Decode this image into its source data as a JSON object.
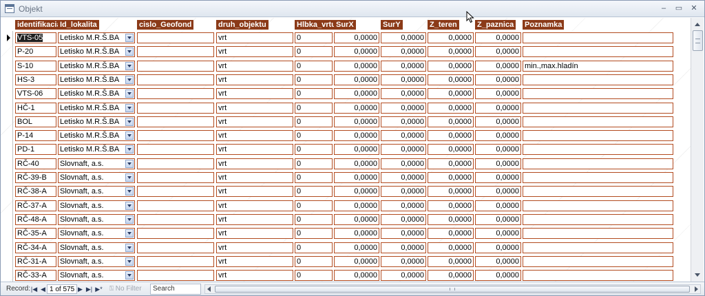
{
  "window": {
    "title": "Objekt"
  },
  "columns": [
    "identifikacia",
    "Id_lokalita",
    "cislo_Geofond",
    "druh_objektu",
    "Hlbka_vrtu",
    "SurX",
    "SurY",
    "Z_teren",
    "Z_paznica",
    "Poznamka"
  ],
  "rows": [
    {
      "identifikacia": "VTS-05",
      "lokalita": "Letisko M.R.Š.BA",
      "geofond": "",
      "druh": "vrt",
      "hlbka": "0",
      "surx": "0,0000",
      "sury": "0,0000",
      "zteren": "0,0000",
      "zpaznica": "0,0000",
      "poznamka": ""
    },
    {
      "identifikacia": "P-20",
      "lokalita": "Letisko M.R.Š.BA",
      "geofond": "",
      "druh": "vrt",
      "hlbka": "0",
      "surx": "0,0000",
      "sury": "0,0000",
      "zteren": "0,0000",
      "zpaznica": "0,0000",
      "poznamka": ""
    },
    {
      "identifikacia": "S-10",
      "lokalita": "Letisko M.R.Š.BA",
      "geofond": "",
      "druh": "vrt",
      "hlbka": "0",
      "surx": "0,0000",
      "sury": "0,0000",
      "zteren": "0,0000",
      "zpaznica": "0,0000",
      "poznamka": "min.,max.hladín"
    },
    {
      "identifikacia": "HS-3",
      "lokalita": "Letisko M.R.Š.BA",
      "geofond": "",
      "druh": "vrt",
      "hlbka": "0",
      "surx": "0,0000",
      "sury": "0,0000",
      "zteren": "0,0000",
      "zpaznica": "0,0000",
      "poznamka": ""
    },
    {
      "identifikacia": "VTS-06",
      "lokalita": "Letisko M.R.Š.BA",
      "geofond": "",
      "druh": "vrt",
      "hlbka": "0",
      "surx": "0,0000",
      "sury": "0,0000",
      "zteren": "0,0000",
      "zpaznica": "0,0000",
      "poznamka": ""
    },
    {
      "identifikacia": "HČ-1",
      "lokalita": "Letisko M.R.Š.BA",
      "geofond": "",
      "druh": "vrt",
      "hlbka": "0",
      "surx": "0,0000",
      "sury": "0,0000",
      "zteren": "0,0000",
      "zpaznica": "0,0000",
      "poznamka": ""
    },
    {
      "identifikacia": "BOL",
      "lokalita": "Letisko M.R.Š.BA",
      "geofond": "",
      "druh": "vrt",
      "hlbka": "0",
      "surx": "0,0000",
      "sury": "0,0000",
      "zteren": "0,0000",
      "zpaznica": "0,0000",
      "poznamka": ""
    },
    {
      "identifikacia": "P-14",
      "lokalita": "Letisko M.R.Š.BA",
      "geofond": "",
      "druh": "vrt",
      "hlbka": "0",
      "surx": "0,0000",
      "sury": "0,0000",
      "zteren": "0,0000",
      "zpaznica": "0,0000",
      "poznamka": ""
    },
    {
      "identifikacia": "PD-1",
      "lokalita": "Letisko M.R.Š.BA",
      "geofond": "",
      "druh": "vrt",
      "hlbka": "0",
      "surx": "0,0000",
      "sury": "0,0000",
      "zteren": "0,0000",
      "zpaznica": "0,0000",
      "poznamka": ""
    },
    {
      "identifikacia": "RČ-40",
      "lokalita": "Slovnaft, a.s.",
      "geofond": "",
      "druh": "vrt",
      "hlbka": "0",
      "surx": "0,0000",
      "sury": "0,0000",
      "zteren": "0,0000",
      "zpaznica": "0,0000",
      "poznamka": ""
    },
    {
      "identifikacia": "RČ-39-B",
      "lokalita": "Slovnaft, a.s.",
      "geofond": "",
      "druh": "vrt",
      "hlbka": "0",
      "surx": "0,0000",
      "sury": "0,0000",
      "zteren": "0,0000",
      "zpaznica": "0,0000",
      "poznamka": ""
    },
    {
      "identifikacia": "RČ-38-A",
      "lokalita": "Slovnaft, a.s.",
      "geofond": "",
      "druh": "vrt",
      "hlbka": "0",
      "surx": "0,0000",
      "sury": "0,0000",
      "zteren": "0,0000",
      "zpaznica": "0,0000",
      "poznamka": ""
    },
    {
      "identifikacia": "RČ-37-A",
      "lokalita": "Slovnaft, a.s.",
      "geofond": "",
      "druh": "vrt",
      "hlbka": "0",
      "surx": "0,0000",
      "sury": "0,0000",
      "zteren": "0,0000",
      "zpaznica": "0,0000",
      "poznamka": ""
    },
    {
      "identifikacia": "RČ-48-A",
      "lokalita": "Slovnaft, a.s.",
      "geofond": "",
      "druh": "vrt",
      "hlbka": "0",
      "surx": "0,0000",
      "sury": "0,0000",
      "zteren": "0,0000",
      "zpaznica": "0,0000",
      "poznamka": ""
    },
    {
      "identifikacia": "RČ-35-A",
      "lokalita": "Slovnaft, a.s.",
      "geofond": "",
      "druh": "vrt",
      "hlbka": "0",
      "surx": "0,0000",
      "sury": "0,0000",
      "zteren": "0,0000",
      "zpaznica": "0,0000",
      "poznamka": ""
    },
    {
      "identifikacia": "RČ-34-A",
      "lokalita": "Slovnaft, a.s.",
      "geofond": "",
      "druh": "vrt",
      "hlbka": "0",
      "surx": "0,0000",
      "sury": "0,0000",
      "zteren": "0,0000",
      "zpaznica": "0,0000",
      "poznamka": ""
    },
    {
      "identifikacia": "RČ-31-A",
      "lokalita": "Slovnaft, a.s.",
      "geofond": "",
      "druh": "vrt",
      "hlbka": "0",
      "surx": "0,0000",
      "sury": "0,0000",
      "zteren": "0,0000",
      "zpaznica": "0,0000",
      "poznamka": ""
    },
    {
      "identifikacia": "RČ-33-A",
      "lokalita": "Slovnaft, a.s.",
      "geofond": "",
      "druh": "vrt",
      "hlbka": "0",
      "surx": "0,0000",
      "sury": "0,0000",
      "zteren": "0,0000",
      "zpaznica": "0,0000",
      "poznamka": ""
    }
  ],
  "status": {
    "record_label": "Record:",
    "position": "1 of 575",
    "filter_label": "No Filter",
    "search_label": "Search"
  },
  "colors": {
    "header_bg": "#8b3a18",
    "cell_border": "#b24a1e"
  },
  "icons": [
    "form-icon",
    "minimize-icon",
    "restore-icon",
    "close-icon",
    "dropdown-arrow-icon",
    "record-selector-arrow-icon",
    "filter-icon"
  ]
}
